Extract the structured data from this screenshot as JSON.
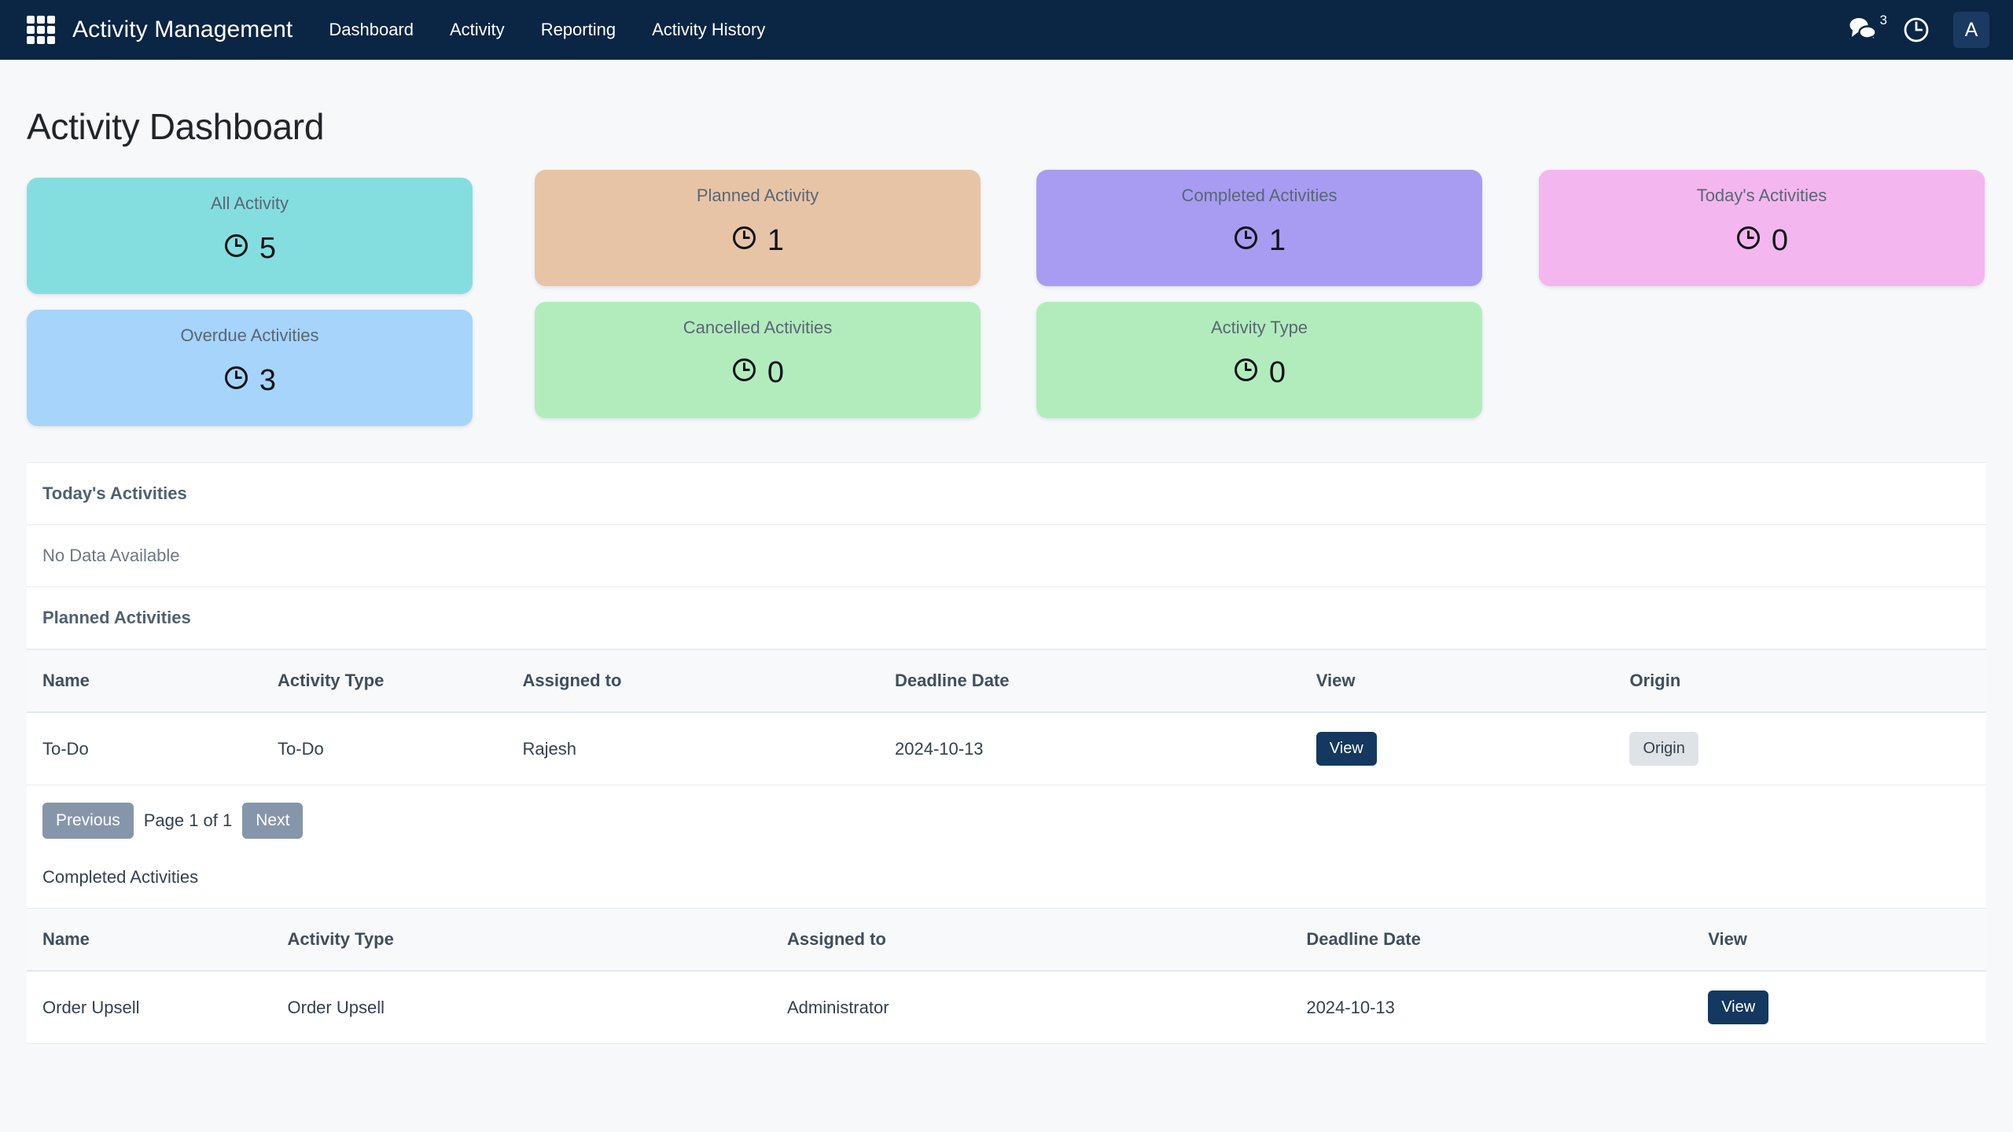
{
  "navbar": {
    "brand": "Activity Management",
    "menu_icon": "grid-apps-icon",
    "links": [
      {
        "label": "Dashboard"
      },
      {
        "label": "Activity"
      },
      {
        "label": "Reporting"
      },
      {
        "label": "Activity History"
      }
    ],
    "chat_badge": "3",
    "chat_icon": "chat-bubbles-icon",
    "clock_icon": "clock-icon",
    "avatar_initial": "A",
    "background_color": "#0b2545"
  },
  "page": {
    "title": "Activity Dashboard",
    "background_color": "#f6f8fa"
  },
  "stat_cards": [
    {
      "label": "All Activity",
      "value": "5",
      "color": "#84dee0",
      "icon": "clock-icon"
    },
    {
      "label": "Overdue Activities",
      "value": "3",
      "color": "#a6d4fb",
      "icon": "clock-icon"
    },
    {
      "label": "Planned Activity",
      "value": "1",
      "color": "#e8c4a7",
      "icon": "clock-icon"
    },
    {
      "label": "Cancelled Activities",
      "value": "0",
      "color": "#b2ecbd",
      "icon": "clock-icon"
    },
    {
      "label": "Completed Activities",
      "value": "1",
      "color": "#a79cf2",
      "icon": "clock-icon"
    },
    {
      "label": "Activity Type",
      "value": "0",
      "color": "#b2ecbd",
      "icon": "clock-icon"
    },
    {
      "label": "Today's Activities",
      "value": "0",
      "color": "#f4b6ef",
      "icon": "clock-icon"
    }
  ],
  "todays_activities": {
    "heading": "Today's Activities",
    "empty_message": "No Data Available"
  },
  "planned_activities": {
    "heading": "Planned Activities",
    "columns": [
      "Name",
      "Activity Type",
      "Assigned to",
      "Deadline Date",
      "View",
      "Origin"
    ],
    "rows": [
      {
        "name": "To-Do",
        "activity_type": "To-Do",
        "assigned_to": "Rajesh",
        "deadline_date": "2024-10-13",
        "view_label": "View",
        "origin_label": "Origin"
      }
    ],
    "pagination": {
      "previous_label": "Previous",
      "page_label": "Page 1 of 1",
      "next_label": "Next"
    }
  },
  "completed_activities": {
    "heading": "Completed Activities",
    "columns": [
      "Name",
      "Activity Type",
      "Assigned to",
      "Deadline Date",
      "View"
    ],
    "rows": [
      {
        "name": "Order Upsell",
        "activity_type": "Order Upsell",
        "assigned_to": "Administrator",
        "deadline_date": "2024-10-13",
        "view_label": "View"
      }
    ]
  }
}
